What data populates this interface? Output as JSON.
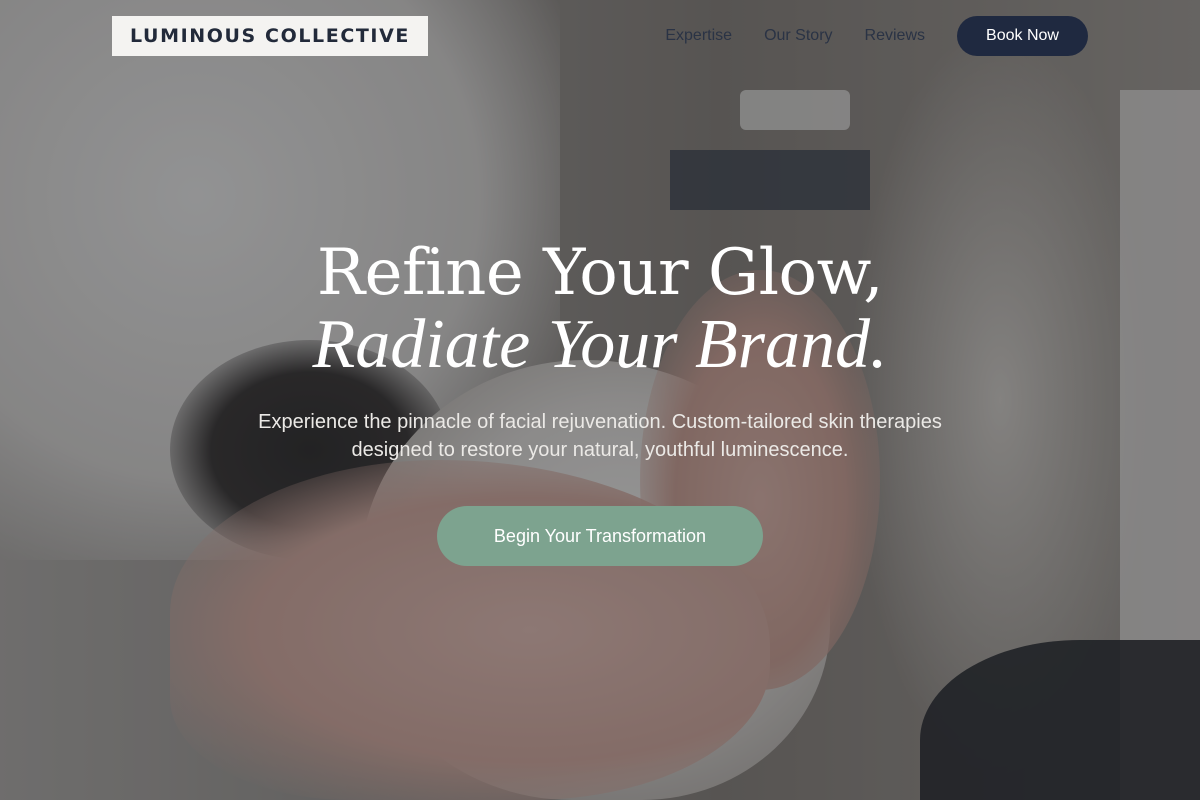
{
  "brand": {
    "logo_text": "LUMINOUS COLLECTIVE"
  },
  "nav": {
    "links": [
      "Expertise",
      "Our Story",
      "Reviews"
    ],
    "cta_label": "Book Now"
  },
  "hero": {
    "headline_line1": "Refine Your Glow,",
    "headline_line2": "Radiate Your Brand.",
    "subtitle": "Experience the pinnacle of facial rejuvenation. Custom-tailored skin therapies designed to restore your natural, youthful luminescence.",
    "cta_label": "Begin Your Transformation",
    "background_image": "facial-treatment-photo"
  },
  "colors": {
    "primary_navy": "#1f2940",
    "accent_sage": "#7da38f",
    "logo_bg": "#f4f3f1",
    "text_white": "#ffffff"
  }
}
